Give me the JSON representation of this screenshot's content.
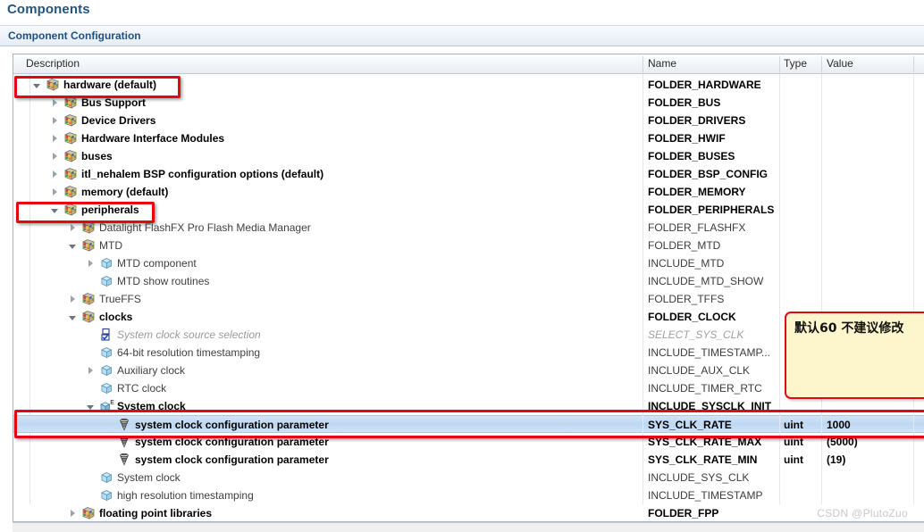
{
  "page": {
    "title": "Components",
    "section_title": "Component Configuration",
    "watermark": "CSDN @PlutoZuo"
  },
  "columns": [
    {
      "key": "description",
      "label": "Description"
    },
    {
      "key": "name",
      "label": "Name"
    },
    {
      "key": "type",
      "label": "Type"
    },
    {
      "key": "value",
      "label": "Value"
    }
  ],
  "tree": {
    "rows": [
      {
        "description": "hardware (default)",
        "name": "FOLDER_HARDWARE",
        "type": "",
        "value": "",
        "depth": 0,
        "twisty": "expanded",
        "icon": "folder-icon",
        "desc_style": "bold",
        "name_style": "bold",
        "selected": false
      },
      {
        "description": "Bus Support",
        "name": "FOLDER_BUS",
        "type": "",
        "value": "",
        "depth": 1,
        "twisty": "collapsed",
        "icon": "folder-icon",
        "desc_style": "bold",
        "name_style": "bold",
        "selected": false
      },
      {
        "description": "Device Drivers",
        "name": "FOLDER_DRIVERS",
        "type": "",
        "value": "",
        "depth": 1,
        "twisty": "collapsed",
        "icon": "folder-icon",
        "desc_style": "bold",
        "name_style": "bold",
        "selected": false
      },
      {
        "description": "Hardware Interface Modules",
        "name": "FOLDER_HWIF",
        "type": "",
        "value": "",
        "depth": 1,
        "twisty": "collapsed",
        "icon": "folder-icon",
        "desc_style": "bold",
        "name_style": "bold",
        "selected": false
      },
      {
        "description": "buses",
        "name": "FOLDER_BUSES",
        "type": "",
        "value": "",
        "depth": 1,
        "twisty": "collapsed",
        "icon": "folder-icon",
        "desc_style": "bold",
        "name_style": "bold",
        "selected": false
      },
      {
        "description": "itl_nehalem BSP configuration options (default)",
        "name": "FOLDER_BSP_CONFIG",
        "type": "",
        "value": "",
        "depth": 1,
        "twisty": "collapsed",
        "icon": "folder-icon",
        "desc_style": "bold",
        "name_style": "bold",
        "selected": false
      },
      {
        "description": "memory (default)",
        "name": "FOLDER_MEMORY",
        "type": "",
        "value": "",
        "depth": 1,
        "twisty": "collapsed",
        "icon": "folder-icon",
        "desc_style": "bold",
        "name_style": "bold",
        "selected": false
      },
      {
        "description": "peripherals",
        "name": "FOLDER_PERIPHERALS",
        "type": "",
        "value": "",
        "depth": 1,
        "twisty": "expanded",
        "icon": "folder-icon",
        "desc_style": "bold",
        "name_style": "bold",
        "selected": false
      },
      {
        "description": "Datalight FlashFX Pro Flash Media Manager",
        "name": "FOLDER_FLASHFX",
        "type": "",
        "value": "",
        "depth": 2,
        "twisty": "collapsed",
        "icon": "folder-icon",
        "desc_style": "grey",
        "name_style": "grey",
        "selected": false
      },
      {
        "description": "MTD",
        "name": "FOLDER_MTD",
        "type": "",
        "value": "",
        "depth": 2,
        "twisty": "expanded",
        "icon": "folder-icon",
        "desc_style": "grey",
        "name_style": "grey",
        "selected": false
      },
      {
        "description": "MTD component",
        "name": "INCLUDE_MTD",
        "type": "",
        "value": "",
        "depth": 3,
        "twisty": "collapsed",
        "icon": "component-icon",
        "desc_style": "grey",
        "name_style": "grey",
        "selected": false
      },
      {
        "description": "MTD show routines",
        "name": "INCLUDE_MTD_SHOW",
        "type": "",
        "value": "",
        "depth": 3,
        "twisty": "none",
        "icon": "component-icon",
        "desc_style": "grey",
        "name_style": "grey",
        "selected": false
      },
      {
        "description": "TrueFFS",
        "name": "FOLDER_TFFS",
        "type": "",
        "value": "",
        "depth": 2,
        "twisty": "collapsed",
        "icon": "folder-icon",
        "desc_style": "grey",
        "name_style": "grey",
        "selected": false
      },
      {
        "description": "clocks",
        "name": "FOLDER_CLOCK",
        "type": "",
        "value": "",
        "depth": 2,
        "twisty": "expanded",
        "icon": "folder-icon",
        "desc_style": "bold",
        "name_style": "bold",
        "selected": false
      },
      {
        "description": "System clock source selection",
        "name": "SELECT_SYS_CLK",
        "type": "",
        "value": "",
        "depth": 3,
        "twisty": "none",
        "icon": "selection-icon",
        "desc_style": "italic-grey",
        "name_style": "italic-grey",
        "selected": false
      },
      {
        "description": "64-bit resolution timestamping",
        "name": "INCLUDE_TIMESTAMP...",
        "type": "",
        "value": "",
        "depth": 3,
        "twisty": "none",
        "icon": "component-icon",
        "desc_style": "grey",
        "name_style": "grey",
        "selected": false
      },
      {
        "description": "Auxiliary clock",
        "name": "INCLUDE_AUX_CLK",
        "type": "",
        "value": "",
        "depth": 3,
        "twisty": "collapsed",
        "icon": "component-icon",
        "desc_style": "grey",
        "name_style": "grey",
        "selected": false
      },
      {
        "description": "RTC clock",
        "name": "INCLUDE_TIMER_RTC",
        "type": "",
        "value": "",
        "depth": 3,
        "twisty": "none",
        "icon": "component-icon",
        "desc_style": "grey",
        "name_style": "grey",
        "selected": false
      },
      {
        "description": "System clock",
        "name": "INCLUDE_SYSCLK_INIT",
        "type": "",
        "value": "",
        "depth": 3,
        "twisty": "expanded",
        "icon": "sysclock-icon",
        "desc_style": "bold",
        "name_style": "bold",
        "selected": false
      },
      {
        "description": "system clock configuration parameter",
        "name": "SYS_CLK_RATE",
        "type": "uint",
        "value": "1000",
        "depth": 4,
        "twisty": "none",
        "icon": "parameter-icon",
        "desc_style": "bold",
        "name_style": "bold",
        "selected": true
      },
      {
        "description": "system clock configuration parameter",
        "name": "SYS_CLK_RATE_MAX",
        "type": "uint",
        "value": "(5000)",
        "depth": 4,
        "twisty": "none",
        "icon": "parameter-icon",
        "desc_style": "bold",
        "name_style": "bold",
        "selected": false
      },
      {
        "description": "system clock configuration parameter",
        "name": "SYS_CLK_RATE_MIN",
        "type": "uint",
        "value": "(19)",
        "depth": 4,
        "twisty": "none",
        "icon": "parameter-icon",
        "desc_style": "bold",
        "name_style": "bold",
        "selected": false
      },
      {
        "description": "System clock",
        "name": "INCLUDE_SYS_CLK",
        "type": "",
        "value": "",
        "depth": 3,
        "twisty": "none",
        "icon": "component-icon",
        "desc_style": "grey",
        "name_style": "grey",
        "selected": false
      },
      {
        "description": "high resolution timestamping",
        "name": "INCLUDE_TIMESTAMP",
        "type": "",
        "value": "",
        "depth": 3,
        "twisty": "none",
        "icon": "component-icon",
        "desc_style": "grey",
        "name_style": "grey",
        "selected": false
      },
      {
        "description": "floating point libraries",
        "name": "FOLDER_FPP",
        "type": "",
        "value": "",
        "depth": 2,
        "twisty": "collapsed",
        "icon": "folder-icon",
        "desc_style": "bold",
        "name_style": "bold",
        "selected": false
      }
    ]
  },
  "annotations": {
    "note": {
      "text": "默认60 不建议修改"
    },
    "highlight_color": "#e30613",
    "boxes": [
      {
        "target": "hardware (default)"
      },
      {
        "target": "peripherals"
      },
      {
        "target": "SYS_CLK_RATE"
      }
    ]
  }
}
